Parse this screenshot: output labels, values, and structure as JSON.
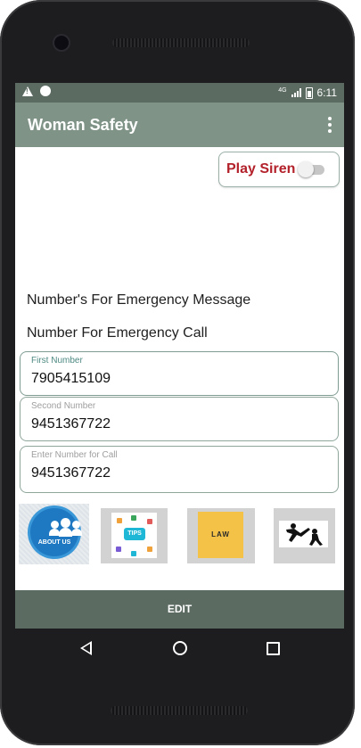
{
  "status_bar": {
    "network": "4G",
    "time": "6:11"
  },
  "app_bar": {
    "title": "Woman Safety",
    "menu_icon": "more-vert-icon"
  },
  "siren": {
    "label": "Play Siren",
    "enabled": false,
    "label_color": "#b3212a"
  },
  "headings": {
    "emergency_message": "Number's For Emergency Message",
    "emergency_call": "Number For Emergency Call"
  },
  "fields": {
    "first": {
      "hint": "First Number",
      "value": "7905415109"
    },
    "second": {
      "hint": "Second Number",
      "value": "9451367722"
    },
    "call": {
      "hint": "Enter Number for Call",
      "value": "9451367722"
    }
  },
  "tiles": {
    "about": {
      "label": "ABOUT US"
    },
    "tips": {
      "label": "TIPS"
    },
    "law": {
      "label": "LAW"
    },
    "karate": {
      "icon": "martial-arts-icon"
    }
  },
  "edit_button": {
    "label": "EDIT"
  },
  "colors": {
    "status_bar": "#5b6b62",
    "app_bar": "#7f9387",
    "accent_border": "#8fa69b"
  }
}
